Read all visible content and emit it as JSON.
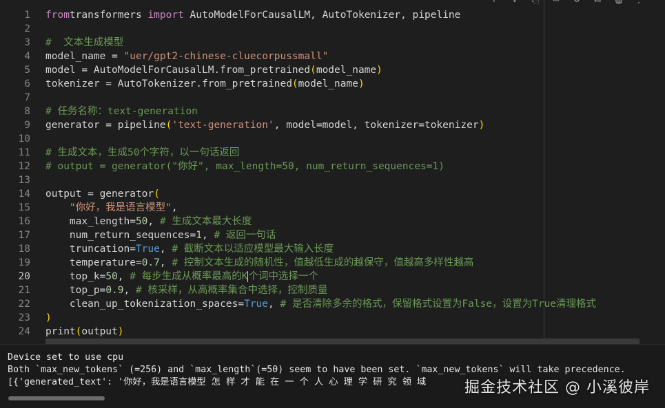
{
  "toolbar": {
    "icons": [
      "arrow-up-icon",
      "arrow-down-icon",
      "link-icon",
      "comment-icon",
      "settings-icon",
      "copy-icon",
      "delete-icon",
      "more-icon"
    ]
  },
  "editor": {
    "active_line": "20",
    "lines": [
      {
        "n": "1",
        "tokens": [
          [
            "kw",
            "from"
          ],
          [
            "",
            "transformers "
          ],
          [
            "kw",
            "import"
          ],
          [
            "",
            " AutoModelForCausalLM, AutoTokenizer, pipeline"
          ]
        ]
      },
      {
        "n": "2",
        "tokens": []
      },
      {
        "n": "3",
        "tokens": [
          [
            "cm",
            "#  文本生成模型"
          ]
        ]
      },
      {
        "n": "4",
        "tokens": [
          [
            "",
            "model_name = "
          ],
          [
            "str",
            "\"uer/gpt2-chinese-cluecorpussmall\""
          ]
        ]
      },
      {
        "n": "5",
        "tokens": [
          [
            "",
            "model = AutoModelForCausalLM.from_pretrained"
          ],
          [
            "br",
            "("
          ],
          [
            "",
            "model_name"
          ],
          [
            "br",
            ")"
          ]
        ]
      },
      {
        "n": "6",
        "tokens": [
          [
            "",
            "tokenizer = AutoTokenizer.from_pretrained"
          ],
          [
            "br",
            "("
          ],
          [
            "",
            "model_name"
          ],
          [
            "br",
            ")"
          ]
        ]
      },
      {
        "n": "7",
        "tokens": []
      },
      {
        "n": "8",
        "tokens": [
          [
            "cm",
            "# 任务名称：text-generation"
          ]
        ]
      },
      {
        "n": "9",
        "tokens": [
          [
            "",
            "generator = pipeline"
          ],
          [
            "br",
            "("
          ],
          [
            "str",
            "'text-generation'"
          ],
          [
            "",
            ", model=model, tokenizer=tokenizer"
          ],
          [
            "br",
            ")"
          ]
        ]
      },
      {
        "n": "10",
        "tokens": []
      },
      {
        "n": "11",
        "tokens": [
          [
            "cm",
            "# 生成文本，生成50个字符，以一句话返回"
          ]
        ]
      },
      {
        "n": "12",
        "tokens": [
          [
            "cm",
            "# output = generator(\"你好\", max_length=50, num_return_sequences=1)"
          ]
        ]
      },
      {
        "n": "13",
        "tokens": []
      },
      {
        "n": "14",
        "tokens": [
          [
            "",
            "output = generator"
          ],
          [
            "br",
            "("
          ]
        ]
      },
      {
        "n": "15",
        "tokens": [
          [
            "",
            "    "
          ],
          [
            "str",
            "\"你好，我是语言模型\""
          ],
          [
            "",
            ","
          ]
        ]
      },
      {
        "n": "16",
        "tokens": [
          [
            "",
            "    max_length="
          ],
          [
            "num",
            "50"
          ],
          [
            "",
            ", "
          ],
          [
            "cm",
            "# 生成文本最大长度"
          ]
        ]
      },
      {
        "n": "17",
        "tokens": [
          [
            "",
            "    num_return_sequences="
          ],
          [
            "num",
            "1"
          ],
          [
            "",
            ", "
          ],
          [
            "cm",
            "# 返回一句话"
          ]
        ]
      },
      {
        "n": "18",
        "tokens": [
          [
            "",
            "    truncation="
          ],
          [
            "bool",
            "True"
          ],
          [
            "",
            ", "
          ],
          [
            "cm",
            "# 截断文本以适应模型最大输入长度"
          ]
        ]
      },
      {
        "n": "19",
        "tokens": [
          [
            "",
            "    temperature="
          ],
          [
            "num",
            "0.7"
          ],
          [
            "",
            ", "
          ],
          [
            "cm",
            "# 控制文本生成的随机性，值越低生成的越保守，值越高多样性越高"
          ]
        ]
      },
      {
        "n": "20",
        "tokens": [
          [
            "",
            "    top_k="
          ],
          [
            "num",
            "50"
          ],
          [
            "",
            ", "
          ],
          [
            "cm",
            "# 每步生成从概率最高的K"
          ],
          [
            "cursor",
            ""
          ],
          [
            "cm",
            "个词中选择一个"
          ]
        ]
      },
      {
        "n": "21",
        "tokens": [
          [
            "",
            "    top_p="
          ],
          [
            "num",
            "0.9"
          ],
          [
            "",
            ", "
          ],
          [
            "cm",
            "# 核采样，从高概率集合中选择，控制质量"
          ]
        ]
      },
      {
        "n": "22",
        "tokens": [
          [
            "",
            "    clean_up_tokenization_spaces="
          ],
          [
            "bool",
            "True"
          ],
          [
            "",
            ", "
          ],
          [
            "cm",
            "# 是否清除多余的格式，保留格式设置为False，设置为True清理格式"
          ]
        ]
      },
      {
        "n": "23",
        "tokens": [
          [
            "br",
            ")"
          ]
        ]
      },
      {
        "n": "24",
        "tokens": [
          [
            "",
            "print"
          ],
          [
            "br",
            "("
          ],
          [
            "",
            "output"
          ],
          [
            "br",
            ")"
          ]
        ]
      }
    ]
  },
  "output": {
    "lines": [
      "Device set to use cpu",
      "Both `max_new_tokens` (=256) and `max_length`(=50) seem to have been set. `max_new_tokens` will take precedence.",
      "[{'generated_text': '你好，我是语言模型 怎 样 才 能 在 一 个 人 心 理 学 研 究 领 域"
    ]
  },
  "watermark": "掘金技术社区 @ 小溪彼岸"
}
